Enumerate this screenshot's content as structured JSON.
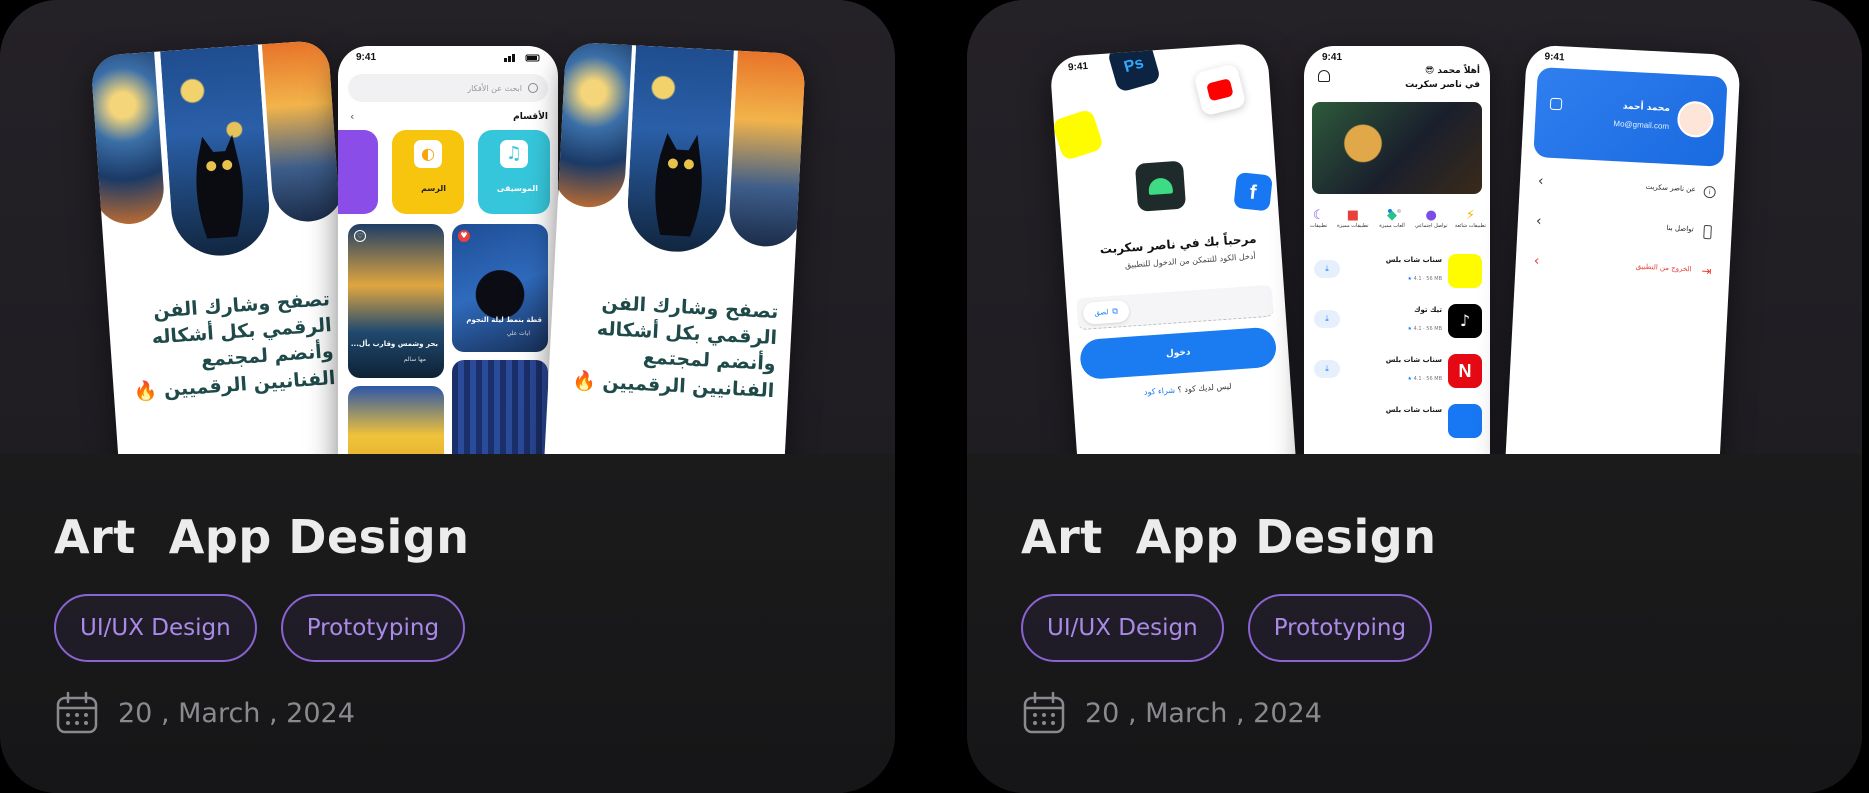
{
  "cards": [
    {
      "title": "Art  App Design",
      "tags": [
        "UI/UX Design",
        "Prototyping"
      ],
      "date": "20 , March , 2024",
      "preview": {
        "phone_time": "9:41",
        "hero_text_lines": [
          "تصفح وشارك الفن",
          "الرقمي بكل أشكاله",
          "وأنضم لمجتمع",
          "الفنانيين الرقميين 🔥"
        ],
        "search_placeholder": "ابحث عن الأفكار",
        "categories_heading": "الأقسام",
        "categories": [
          "الموسيقى",
          "الرسم"
        ],
        "art_items": [
          "قطة بنمط ليلة النجوم",
          "بحر وشمس وقارب بأل..."
        ],
        "art_authors": [
          "ايات علي",
          "مها سالم"
        ]
      }
    },
    {
      "title": "Art  App Design",
      "tags": [
        "UI/UX Design",
        "Prototyping"
      ],
      "date": "20 , March , 2024",
      "preview": {
        "phone_time": "9:41",
        "welcome_title": "مرحباً بك في ناصر سكربت",
        "welcome_sub": "أدخل الكود للتتمكن من الدخول للتطبيق",
        "paste_label": "لصق",
        "login_button": "دخول",
        "no_code_text": "ليس لديك كود ؟",
        "buy_code": "شراء كود",
        "greeting_line1": "أهلاً محمد 😎",
        "greeting_line2": "في ناصر سكربت",
        "app_categories": [
          "تطبيقات شائعة",
          "تواصل اجتماعي",
          "ألعاب مميزة",
          "تطبيقات مميزة",
          "تطبيقات"
        ],
        "apps": [
          {
            "name": "سناب شات بلس",
            "size": "56 MB",
            "rating": "4.1",
            "color": "#FFFC00"
          },
          {
            "name": "تيك توك",
            "size": "56 MB",
            "rating": "4.1",
            "color": "#000000"
          },
          {
            "name": "سناب شات بلس",
            "size": "56 MB",
            "rating": "4.1",
            "color": "#E50914"
          },
          {
            "name": "سناب شات بلس",
            "size": "",
            "rating": "",
            "color": "#1877F2"
          }
        ],
        "profile_name": "محمد أحمد",
        "profile_email": "Mo@gmail.com",
        "menu": [
          "عن ناصر سكربت",
          "تواصل بنا",
          "الخروج من التطبيق"
        ]
      }
    }
  ],
  "colors": {
    "tag_border": "#8b63d3",
    "tag_text": "#a98ae6",
    "title": "#ececec",
    "date": "#8a8a8e",
    "primary_blue": "#1a7cf0"
  }
}
